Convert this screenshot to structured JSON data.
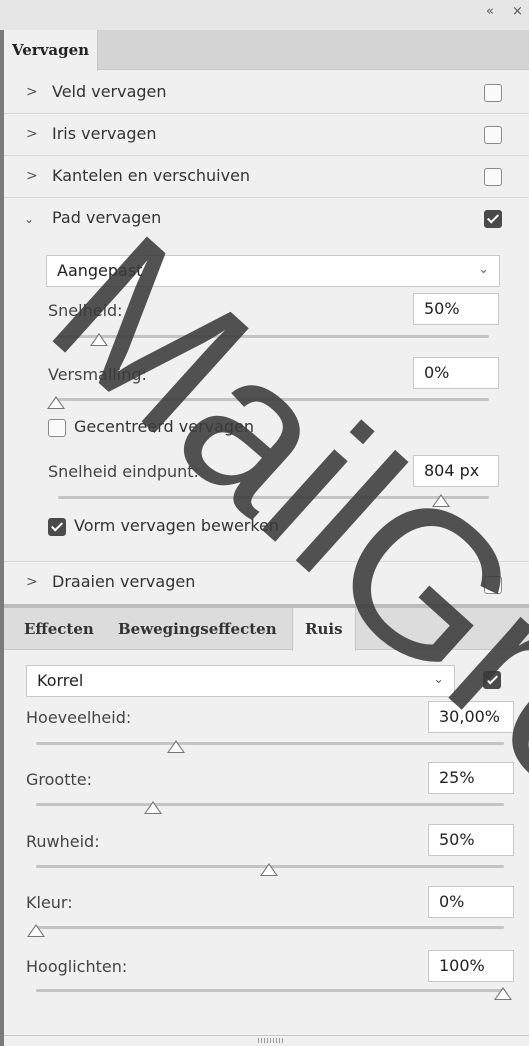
{
  "header": {
    "collapse_glyph": "«",
    "close_glyph": "×"
  },
  "tabs": [
    {
      "label": "Vervagen"
    }
  ],
  "blur_sections": [
    {
      "label": "Veld vervagen",
      "expanded": false,
      "enabled": false
    },
    {
      "label": "Iris vervagen",
      "expanded": false,
      "enabled": false
    },
    {
      "label": "Kantelen en verschuiven",
      "expanded": false,
      "enabled": false
    },
    {
      "label": "Pad vervagen",
      "expanded": true,
      "enabled": true
    },
    {
      "label": "Draaien vervagen",
      "expanded": false,
      "enabled": false
    }
  ],
  "path_blur": {
    "preset": "Aangepast",
    "speed": {
      "label": "Snelheid:",
      "value": "50%",
      "level": 0.5
    },
    "taper": {
      "label": "Versmalling:",
      "value": "0%",
      "level": 0.0
    },
    "centered": {
      "label": "Gecentreerd vervagen",
      "checked": false
    },
    "endpoint_speed": {
      "label": "Snelheid eindpunt:",
      "value": "804 px",
      "level": 0.885
    },
    "edit_shapes": {
      "label": "Vorm vervagen bewerken",
      "checked": true
    }
  },
  "effect_tabs": [
    {
      "label": "Effecten"
    },
    {
      "label": "Bewegingseffecten"
    },
    {
      "label": "Ruis"
    }
  ],
  "noise": {
    "type": "Korrel",
    "enabled": true,
    "amount": {
      "label": "Hoeveelheid:",
      "value": "30,00%",
      "level": 0.3
    },
    "size": {
      "label": "Grootte:",
      "value": "25%",
      "level": 0.25
    },
    "roughness": {
      "label": "Ruwheid:",
      "value": "50%",
      "level": 0.5
    },
    "color": {
      "label": "Kleur:",
      "value": "0%",
      "level": 0.0
    },
    "highlights": {
      "label": "Hooglichten:",
      "value": "100%",
      "level": 1.0
    }
  },
  "watermark": {
    "text": "MailGroo",
    "color": "#3a3a3a"
  }
}
